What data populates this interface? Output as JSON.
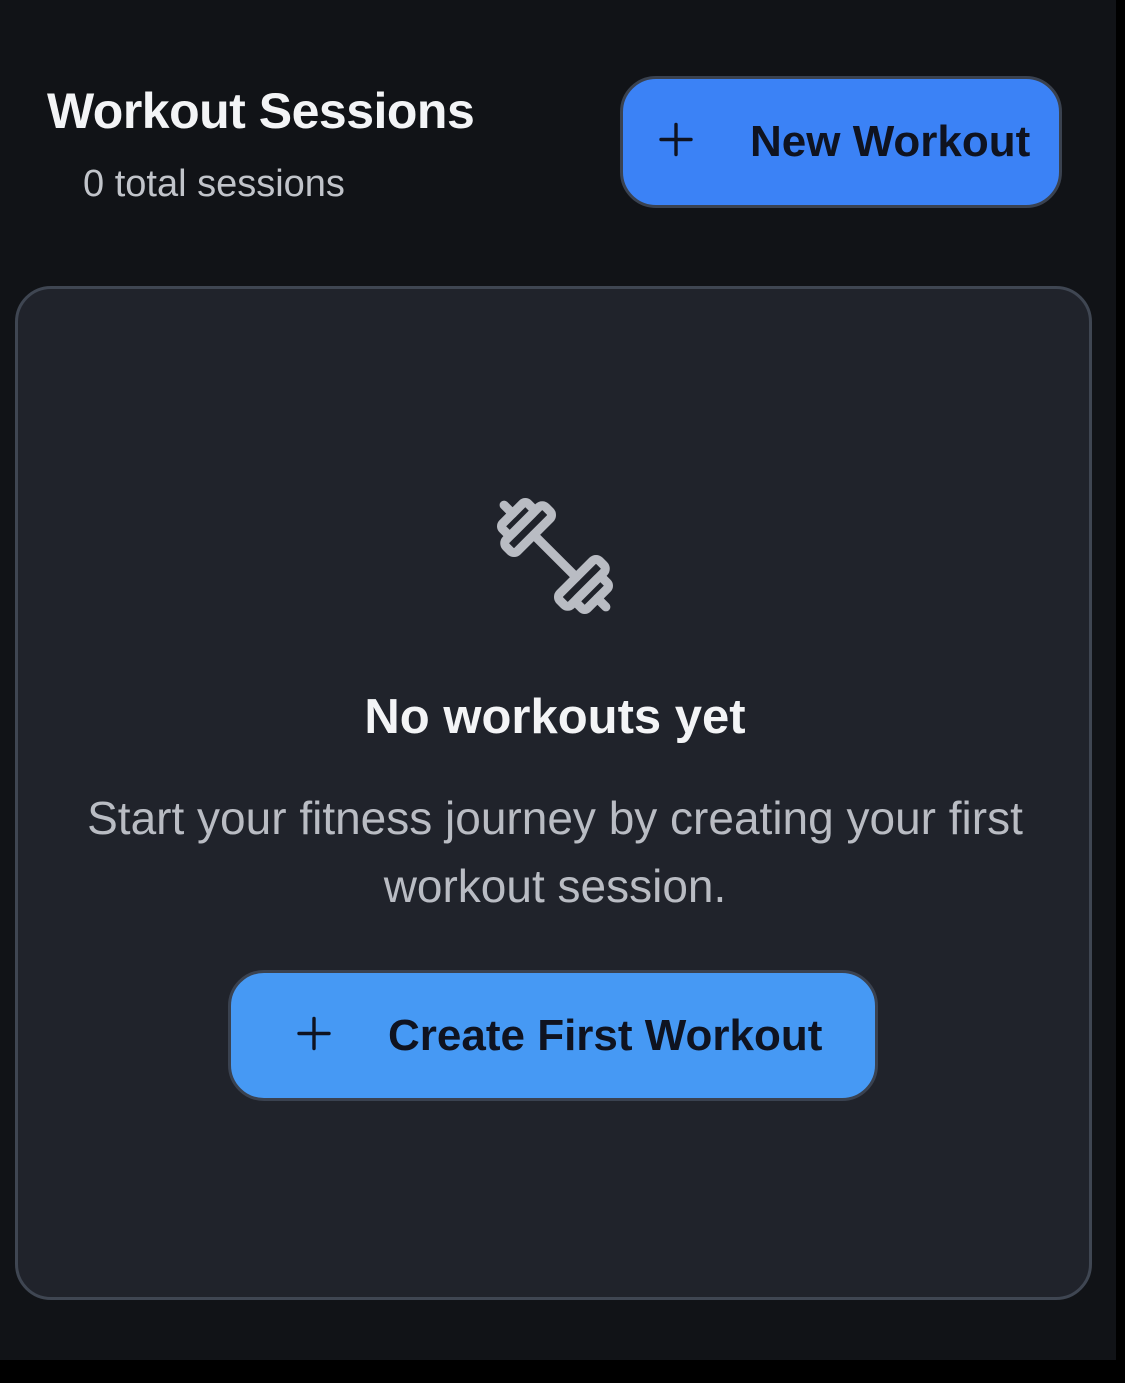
{
  "header": {
    "title": "Workout Sessions",
    "subtitle": "0 total sessions",
    "new_button": {
      "icon": "plus-icon",
      "label": "New Workout"
    }
  },
  "empty_state": {
    "icon": "dumbbell-icon",
    "title": "No workouts yet",
    "description": "Start your fitness journey by creating your first workout session.",
    "create_button": {
      "icon": "plus-icon",
      "label": "Create First Workout"
    }
  },
  "colors": {
    "background": "#111317",
    "card_background": "#20232b",
    "card_border": "#3f4652",
    "primary_button": "#3b82f6",
    "secondary_button": "#4699f4",
    "title_text": "#f3f4f6",
    "muted_text": "#c1c4ca",
    "icon": "#b9bcc3"
  }
}
